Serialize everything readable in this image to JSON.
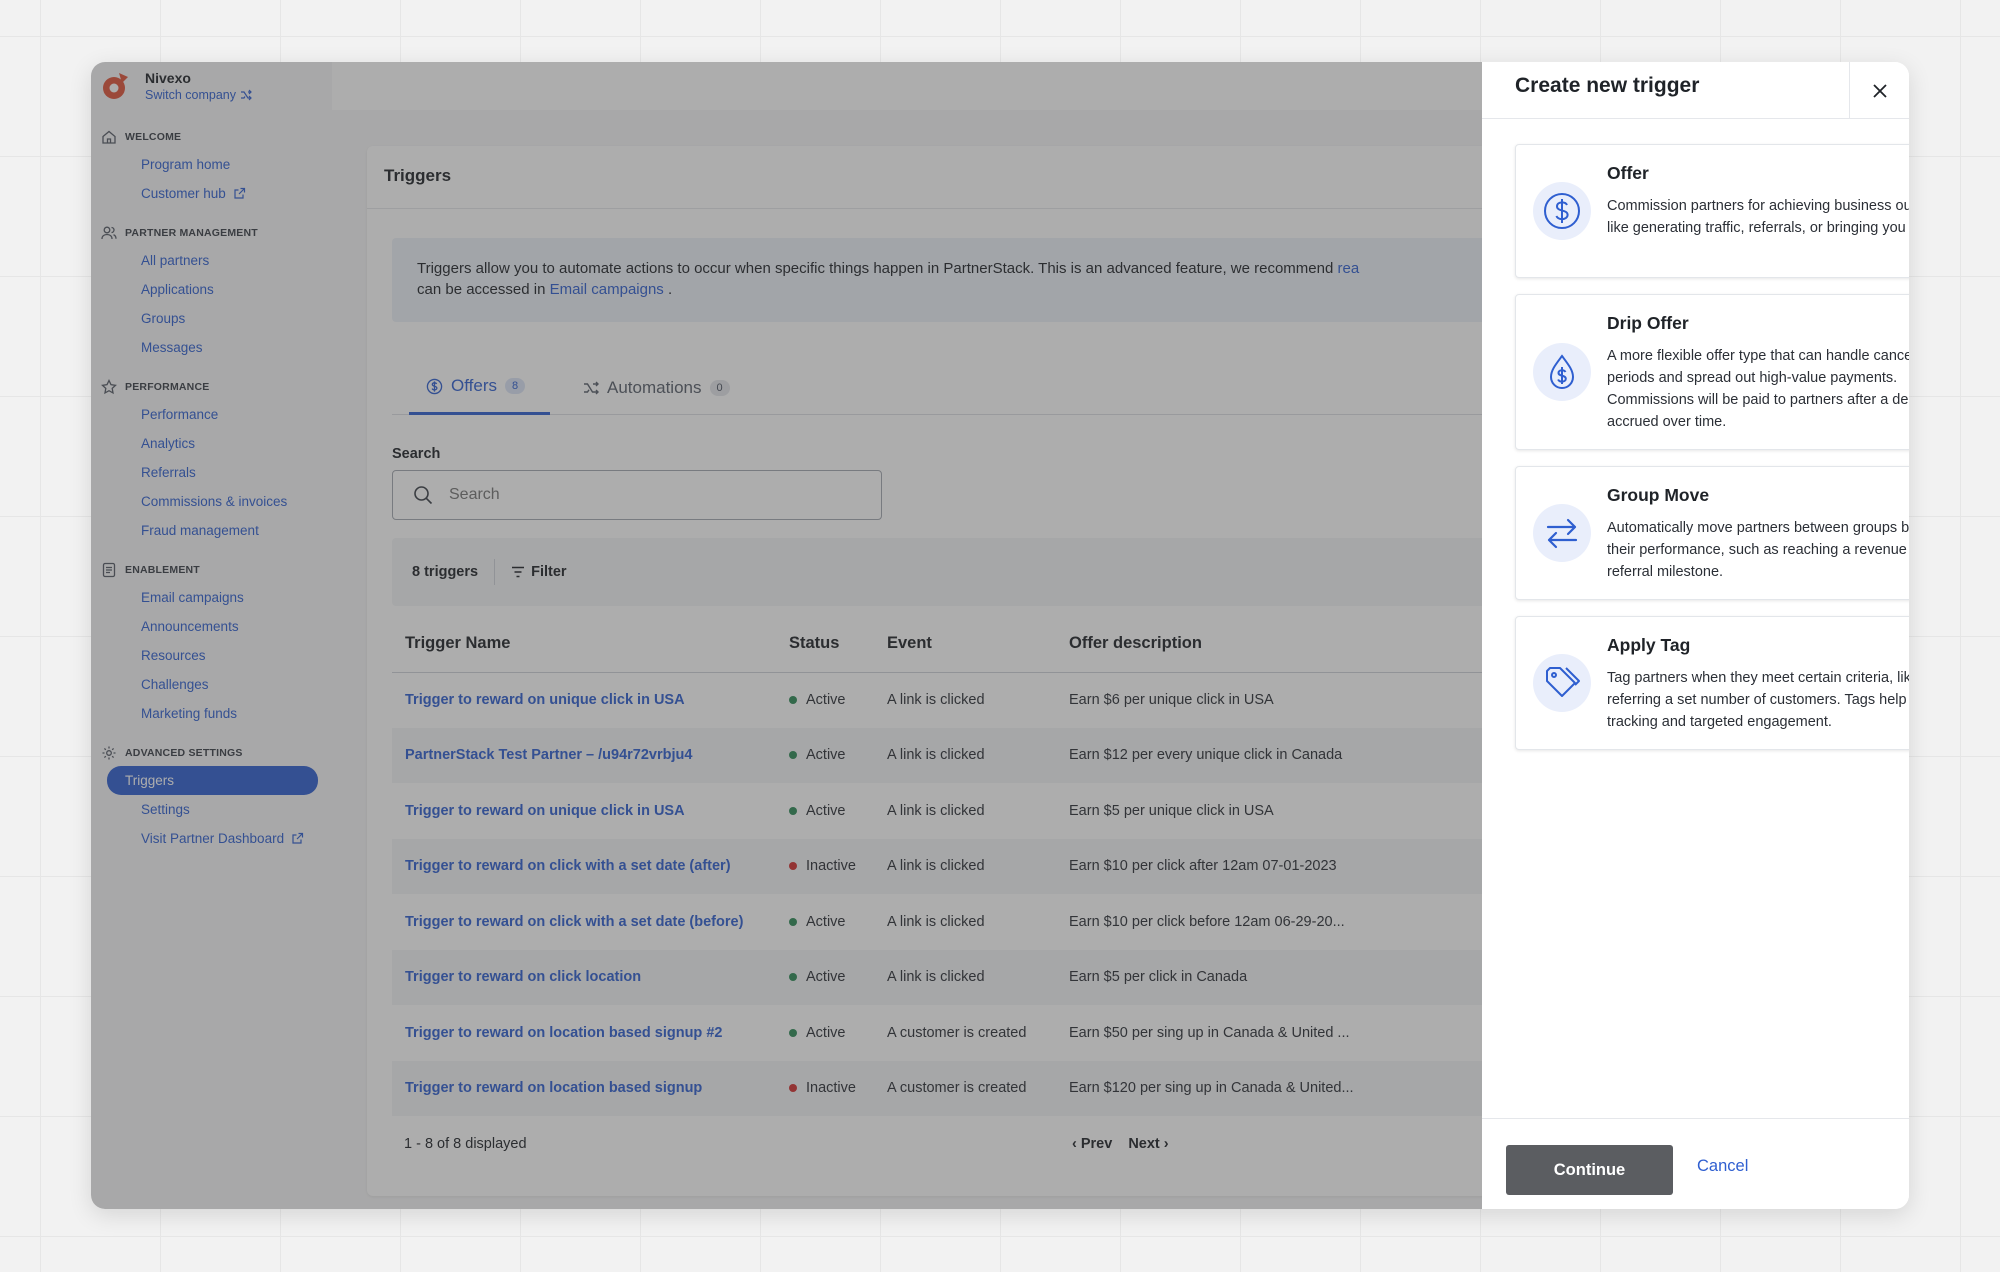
{
  "app": {
    "company": "Nivexo",
    "switch_company": "Switch company"
  },
  "sidebar": {
    "sections": [
      {
        "title": "WELCOME",
        "icon": "home-icon",
        "items": [
          "Program home",
          "Customer hub"
        ]
      },
      {
        "title": "PARTNER MANAGEMENT",
        "icon": "users-icon",
        "items": [
          "All partners",
          "Applications",
          "Groups",
          "Messages"
        ]
      },
      {
        "title": "PERFORMANCE",
        "icon": "star-icon",
        "items": [
          "Performance",
          "Analytics",
          "Referrals",
          "Commissions & invoices",
          "Fraud management"
        ]
      },
      {
        "title": "ENABLEMENT",
        "icon": "document-icon",
        "items": [
          "Email campaigns",
          "Announcements",
          "Resources",
          "Challenges",
          "Marketing funds"
        ]
      },
      {
        "title": "ADVANCED SETTINGS",
        "icon": "gear-icon",
        "items": [
          "Triggers",
          "Settings",
          "Visit Partner Dashboard"
        ]
      }
    ],
    "active_item": "Triggers"
  },
  "main": {
    "title": "Triggers",
    "banner": {
      "text": "Triggers allow you to automate actions to occur when specific things happen in PartnerStack. This is an advanced feature, we recommend",
      "link_fragment": "rea",
      "line2_prefix": "can be accessed in",
      "line2_link": "Email campaigns",
      "line2_suffix": "."
    },
    "tabs": [
      {
        "label": "Offers",
        "count": "8",
        "active": true
      },
      {
        "label": "Automations",
        "count": "0",
        "active": false
      }
    ],
    "search": {
      "label": "Search",
      "placeholder": "Search"
    },
    "filterbar": {
      "count": "8 triggers",
      "filter": "Filter"
    },
    "table": {
      "columns": [
        "Trigger Name",
        "Status",
        "Event",
        "Offer description"
      ],
      "rows": [
        {
          "name": "Trigger to reward on unique click in USA",
          "status": "Active",
          "event": "A link is clicked",
          "desc": "Earn $6 per unique click in USA"
        },
        {
          "name": "PartnerStack Test Partner – /u94r72vrbju4",
          "status": "Active",
          "event": "A link is clicked",
          "desc": "Earn $12 per every unique click in Canada"
        },
        {
          "name": "Trigger to reward on unique click in USA",
          "status": "Active",
          "event": "A link is clicked",
          "desc": "Earn $5 per unique click in USA"
        },
        {
          "name": "Trigger to reward on click with a set date (after)",
          "status": "Inactive",
          "event": "A link is clicked",
          "desc": "Earn $10 per click after 12am 07-01-2023"
        },
        {
          "name": "Trigger to reward on click with a set date (before)",
          "status": "Active",
          "event": "A link is clicked",
          "desc": "Earn $10 per click before 12am 06-29-20..."
        },
        {
          "name": "Trigger to reward on click location",
          "status": "Active",
          "event": "A link is clicked",
          "desc": "Earn $5 per click in Canada"
        },
        {
          "name": "Trigger to reward on location based signup #2",
          "status": "Active",
          "event": "A customer is created",
          "desc": "Earn $50 per sing up in Canada & United ..."
        },
        {
          "name": "Trigger to reward on location based signup",
          "status": "Inactive",
          "event": "A customer is created",
          "desc": "Earn $120 per sing up in Canada & United..."
        }
      ]
    },
    "pager": {
      "summary": "1 - 8 of 8 displayed",
      "prev": "Prev",
      "next": "Next"
    }
  },
  "panel": {
    "title": "Create new trigger",
    "options": [
      {
        "title": "Offer",
        "icon": "dollar-circle-icon",
        "desc": "Commission partners for achieving business outcomes like generating traffic, referrals, or bringing you revenue."
      },
      {
        "title": "Drip Offer",
        "icon": "dollar-drop-icon",
        "desc": "A more flexible offer type that can handle cancellation periods and spread out high-value payments. Commissions will be paid to partners after a delay or accrued over time."
      },
      {
        "title": "Group Move",
        "icon": "swap-arrows-icon",
        "desc": "Automatically move partners between groups based on their performance, such as reaching a revenue or referral milestone."
      },
      {
        "title": "Apply Tag",
        "icon": "tags-icon",
        "desc": "Tag partners when they meet certain criteria, like referring a set number of customers. Tags help with tracking and targeted engagement."
      }
    ],
    "continue": "Continue",
    "cancel": "Cancel"
  },
  "colors": {
    "accent": "#2f5fd0",
    "active_status": "#2e8b57",
    "inactive_status": "#d32f2f",
    "brand": "#e0533a"
  }
}
